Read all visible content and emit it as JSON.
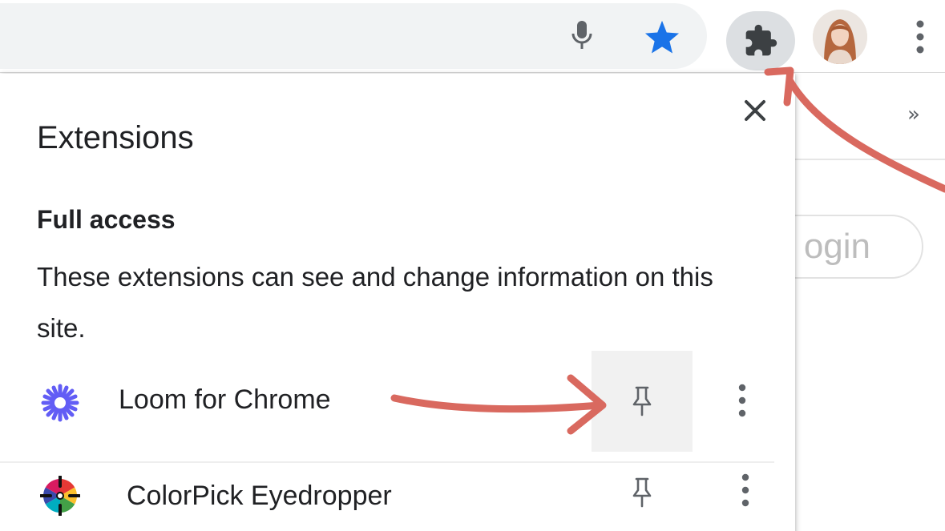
{
  "toolbar": {
    "icons": [
      "microphone-icon",
      "star-icon",
      "extensions-puzzle-icon",
      "avatar",
      "more-vert-icon"
    ],
    "accent_color": "#1a73e8"
  },
  "background_page": {
    "overflow_chevron": "»",
    "login_button_label": "ogin"
  },
  "popup": {
    "title": "Extensions",
    "section": {
      "title": "Full access",
      "description": "These extensions can see and change information on this site."
    },
    "extensions": [
      {
        "name": "Loom for Chrome",
        "icon": "loom-icon",
        "pinned": false,
        "highlighted": true
      },
      {
        "name": "ColorPick Eyedropper",
        "icon": "colorpick-icon",
        "pinned": false,
        "highlighted": false
      }
    ]
  },
  "annotation_color": "#d9695f"
}
